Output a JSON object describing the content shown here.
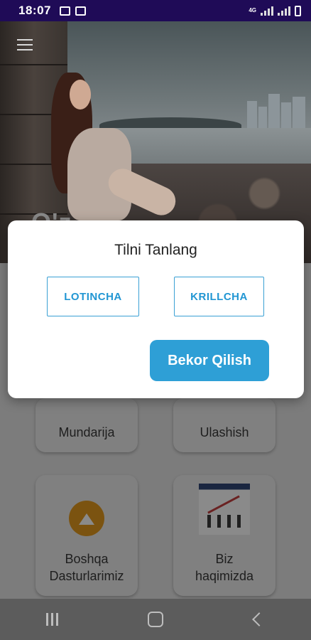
{
  "status_bar": {
    "time": "18:07",
    "network": "4G"
  },
  "hero": {
    "title": "O'z ..."
  },
  "cards": [
    {
      "label": "Mundarija"
    },
    {
      "label": "Ulashish"
    },
    {
      "label_line1": "Boshqa",
      "label_line2": "Dasturlarimiz"
    },
    {
      "label_line1": "Biz",
      "label_line2": "haqimizda"
    }
  ],
  "dialog": {
    "title": "Tilni Tanlang",
    "latin_label": "LOTINCHA",
    "cyrillic_label": "KRILLCHA",
    "cancel_label": "Bekor Qilish"
  },
  "colors": {
    "status_bar": "#1f0b57",
    "accent": "#2e9fd6",
    "scrim": "#7c7c7c"
  }
}
